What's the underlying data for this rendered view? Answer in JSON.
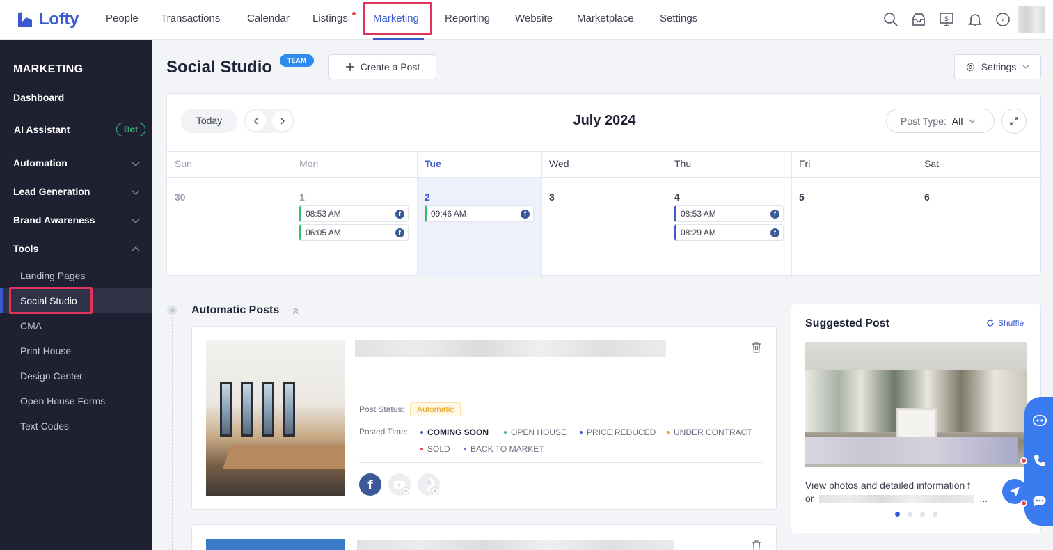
{
  "brand": {
    "name": "Lofty"
  },
  "topnav": {
    "items": [
      "People",
      "Transactions",
      "Calendar",
      "Listings",
      "Marketing",
      "Reporting",
      "Website",
      "Marketplace",
      "Settings"
    ],
    "active": "Marketing"
  },
  "sidebar": {
    "title": "MARKETING",
    "items": [
      {
        "label": "Dashboard"
      },
      {
        "label": "AI Assistant",
        "badge": "Bot"
      },
      {
        "label": "Automation"
      },
      {
        "label": "Lead Generation"
      },
      {
        "label": "Brand Awareness"
      },
      {
        "label": "Tools"
      }
    ],
    "tools": [
      "Landing Pages",
      "Social Studio",
      "CMA",
      "Print House",
      "Design Center",
      "Open House Forms",
      "Text Codes"
    ],
    "selected": "Social Studio"
  },
  "header": {
    "title": "Social Studio",
    "badge": "TEAM",
    "create_label": "Create a Post",
    "settings_label": "Settings"
  },
  "calendar": {
    "today_label": "Today",
    "month": "July 2024",
    "post_type_label": "Post Type:",
    "post_type_value": "All",
    "days": [
      "Sun",
      "Mon",
      "Tue",
      "Wed",
      "Thu",
      "Fri",
      "Sat"
    ],
    "dates": [
      "30",
      "1",
      "2",
      "3",
      "4",
      "5",
      "6"
    ],
    "events": {
      "mon": [
        "08:53 AM",
        "06:05 AM"
      ],
      "tue": [
        "09:46 AM"
      ],
      "thu": [
        "08:53 AM",
        "08:29 AM"
      ]
    }
  },
  "automatic_posts": {
    "title": "Automatic Posts",
    "post_status_label": "Post Status:",
    "post_status_value": "Automatic",
    "posted_time_label": "Posted Time:",
    "tags": [
      "COMING SOON",
      "OPEN HOUSE",
      "PRICE REDUCED",
      "UNDER CONTRACT",
      "SOLD",
      "BACK TO MARKET"
    ],
    "tag_colors": [
      "#3a5bcf",
      "#2fbe72",
      "#3a5bcf",
      "#f0a020",
      "#e5484d",
      "#9b59d0"
    ]
  },
  "suggested": {
    "title": "Suggested Post",
    "shuffle_label": "Shuffle",
    "desc_line1": "View photos and detailed information f",
    "desc_line2": "or"
  }
}
